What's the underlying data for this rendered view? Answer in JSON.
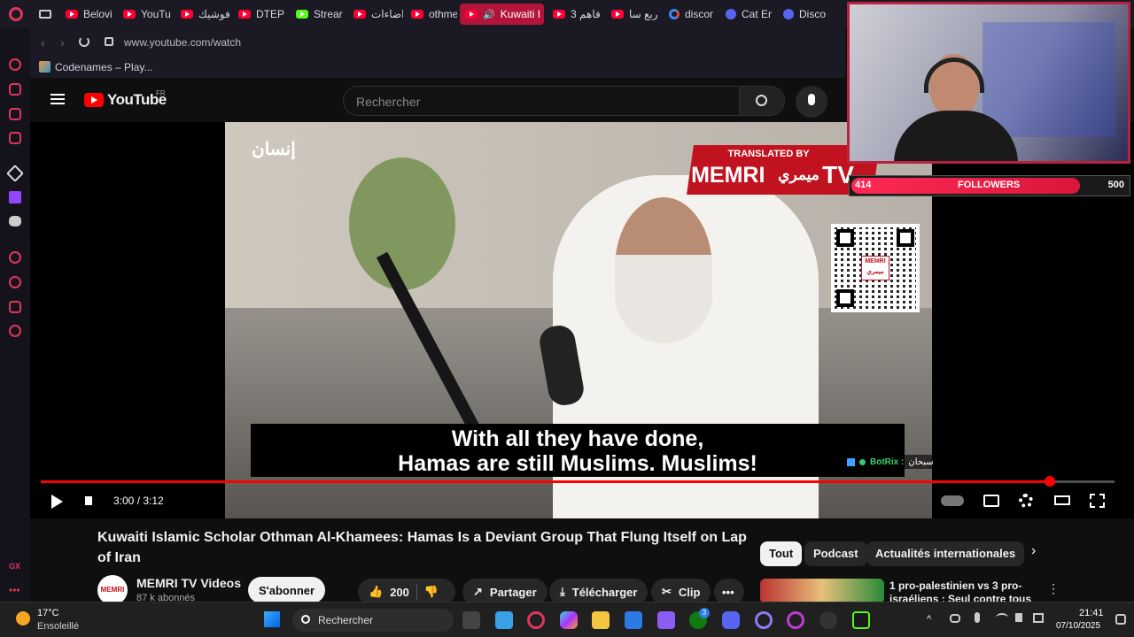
{
  "tabs": [
    {
      "label": "Belovi",
      "icon": "youtube-icon"
    },
    {
      "label": "YouTu",
      "icon": "youtube-icon"
    },
    {
      "label": "فوشيك",
      "icon": "youtube-icon"
    },
    {
      "label": "DTEP",
      "icon": "youtube-icon"
    },
    {
      "label": "Strear",
      "icon": "kick-icon"
    },
    {
      "label": "اضاءات",
      "icon": "youtube-icon"
    },
    {
      "label": "othme",
      "icon": "youtube-icon"
    },
    {
      "label": "Kuwaiti I",
      "icon": "youtube-icon"
    },
    {
      "label": "فاهم 3",
      "icon": "youtube-icon"
    },
    {
      "label": "ربع سا",
      "icon": "youtube-icon"
    },
    {
      "label": "discor",
      "icon": "google-icon"
    },
    {
      "label": "Cat Er",
      "icon": "discord-icon"
    },
    {
      "label": "Disco",
      "icon": "discord-icon"
    }
  ],
  "address": {
    "url": "www.youtube.com/watch"
  },
  "bookmark": {
    "label": "Codenames – Play..."
  },
  "youtube": {
    "logo_text": "YouTube",
    "country": "FR",
    "search_placeholder": "Rechercher"
  },
  "video": {
    "watermark_arabic": "إنسان",
    "subtitle_line1": "With all they have done,",
    "subtitle_line2": "Hamas are still Muslims. Muslims!",
    "time": "3:00 / 3:12",
    "progress_fraction": 0.94,
    "memri_top": "TRANSLATED BY",
    "memri_main": "MEMRI",
    "memri_arabic": "ميمري",
    "memri_tv": "TV",
    "qr_label": "MEMRI",
    "qr_label_ar": "ميمري",
    "chat_name": "BotRix :",
    "chat_text": "سبحان"
  },
  "followers": {
    "current": "414",
    "label": "FOLLOWERS",
    "goal": "500",
    "fraction": 0.828
  },
  "details": {
    "title": "Kuwaiti Islamic Scholar Othman Al-Khamees: Hamas Is a Deviant Group That Flung Itself on Lap of Iran",
    "channel": "MEMRI TV Videos",
    "subscribers": "87 k abonnés",
    "avatar_label": "MEMRI",
    "subscribe": "S'abonner",
    "likes": "200",
    "share": "Partager",
    "download": "Télécharger",
    "clip": "Clip",
    "chips": [
      "Tout",
      "Podcast",
      "Actualités internationales"
    ],
    "rec_title": "1 pro-palestinien vs 3 pro-israéliens : Seul contre tous"
  },
  "taskbar": {
    "temperature": "17°C",
    "weather": "Ensoleillé",
    "search": "Rechercher",
    "time": "21:41",
    "date": "07/10/2025",
    "badge": "3"
  },
  "colors": {
    "youtube_red": "#ff0000",
    "opera_red": "#e0355a",
    "active_tab": "#b3143a"
  }
}
